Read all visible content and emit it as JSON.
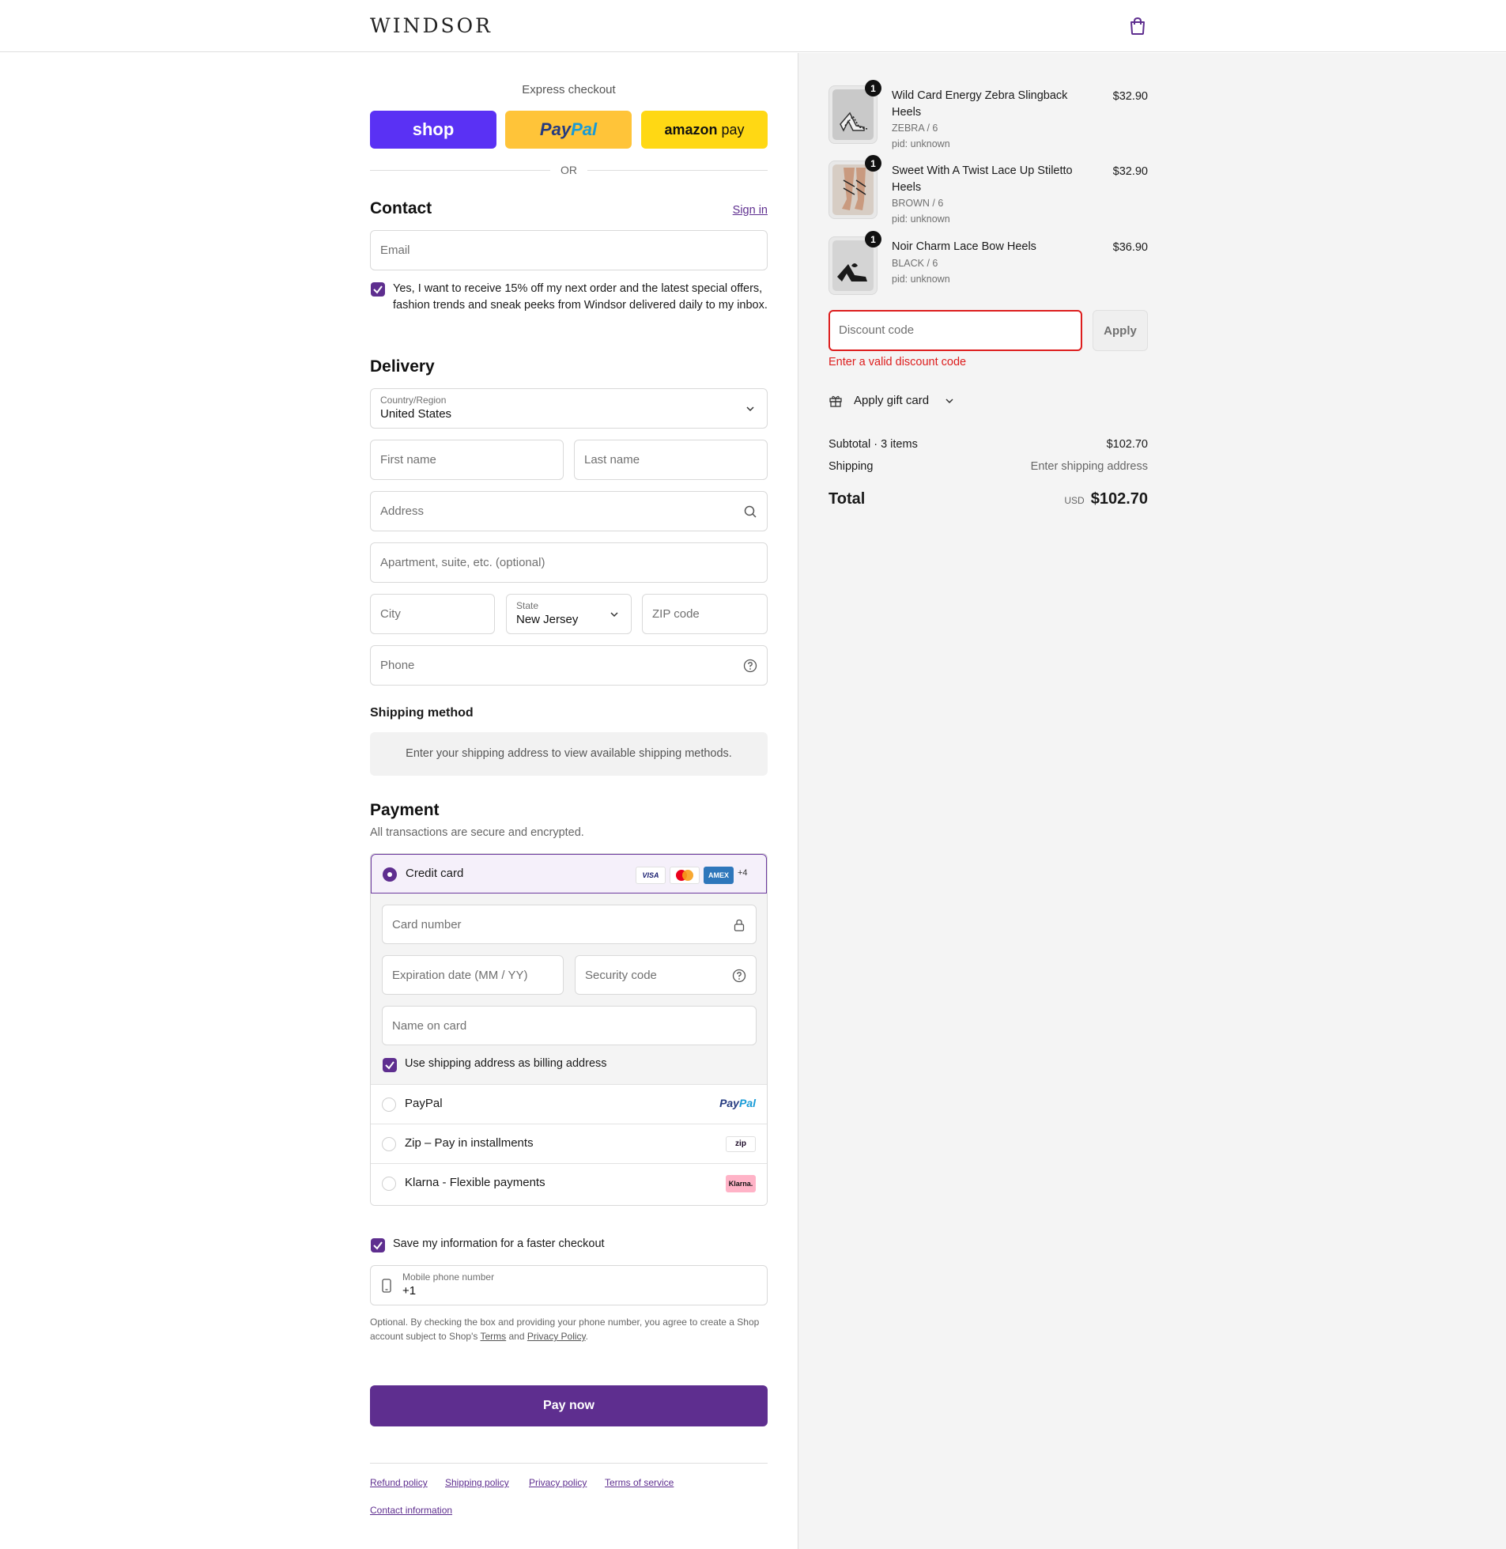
{
  "header": {
    "logo": "WINDSOR"
  },
  "express": {
    "title": "Express checkout",
    "shop_label": "shop",
    "paypal_a": "Pay",
    "paypal_b": "Pal",
    "amazon_a": "amazon",
    "amazon_b": " pay",
    "or": "OR"
  },
  "contact": {
    "title": "Contact",
    "signin": "Sign in",
    "email_placeholder": "Email",
    "newsletter": "Yes, I want to receive 15% off my next order and the latest special offers, fashion trends and sneak peeks from Windsor delivered daily to my inbox."
  },
  "delivery": {
    "title": "Delivery",
    "country_label": "Country/Region",
    "country_value": "United States",
    "first_name": "First name",
    "last_name": "Last name",
    "address": "Address",
    "apartment": "Apartment, suite, etc. (optional)",
    "city": "City",
    "state_label": "State",
    "state_value": "New Jersey",
    "zip": "ZIP code",
    "phone": "Phone"
  },
  "shipping": {
    "title": "Shipping method",
    "message": "Enter your shipping address to view available shipping methods."
  },
  "payment": {
    "title": "Payment",
    "subtitle": "All transactions are secure and encrypted.",
    "credit_card": "Credit card",
    "visa": "VISA",
    "amex": "AMEX",
    "more_cards": "+4",
    "card_number": "Card number",
    "expiration": "Expiration date (MM / YY)",
    "security": "Security code",
    "name_on_card": "Name on card",
    "billing_same": "Use shipping address as billing address",
    "paypal": "PayPal",
    "paypal_logo_a": "Pay",
    "paypal_logo_b": "Pal",
    "zip": "Zip – Pay in installments",
    "zip_logo": "zip",
    "klarna": "Klarna - Flexible payments",
    "klarna_logo": "Klarna."
  },
  "save": {
    "label": "Save my information for a faster checkout",
    "mobile_label": "Mobile phone number",
    "mobile_value": "+1",
    "legal_a": "Optional. By checking the box and providing your phone number, you agree to create a Shop account subject to Shop's ",
    "terms": "Terms",
    "and": " and ",
    "privacy": "Privacy Policy",
    "period": "."
  },
  "pay_now": "Pay now",
  "footer": {
    "refund": "Refund policy",
    "shipping": "Shipping policy",
    "privacy": "Privacy policy",
    "terms": "Terms of service",
    "contact": "Contact information"
  },
  "cart": {
    "items": [
      {
        "qty": "1",
        "name": "Wild Card Energy Zebra Slingback Heels",
        "variant": "ZEBRA / 6",
        "pid": "pid: unknown",
        "price": "$32.90"
      },
      {
        "qty": "1",
        "name": "Sweet With A Twist Lace Up Stiletto Heels",
        "variant": "BROWN / 6",
        "pid": "pid: unknown",
        "price": "$32.90"
      },
      {
        "qty": "1",
        "name": "Noir Charm Lace Bow Heels",
        "variant": "BLACK / 6",
        "pid": "pid: unknown",
        "price": "$36.90"
      }
    ],
    "discount_placeholder": "Discount code",
    "apply": "Apply",
    "discount_error": "Enter a valid discount code",
    "gift_card": "Apply gift card",
    "subtotal_label": "Subtotal · 3 items",
    "subtotal_value": "$102.70",
    "shipping_label": "Shipping",
    "shipping_value": "Enter shipping address",
    "total_label": "Total",
    "currency": "USD",
    "total_value": "$102.70"
  },
  "colors": {
    "accent": "#5e2e8f",
    "error": "#dd1d1d",
    "shop": "#5a31f4",
    "paypal": "#ffc439",
    "amazon": "#ffd814"
  }
}
